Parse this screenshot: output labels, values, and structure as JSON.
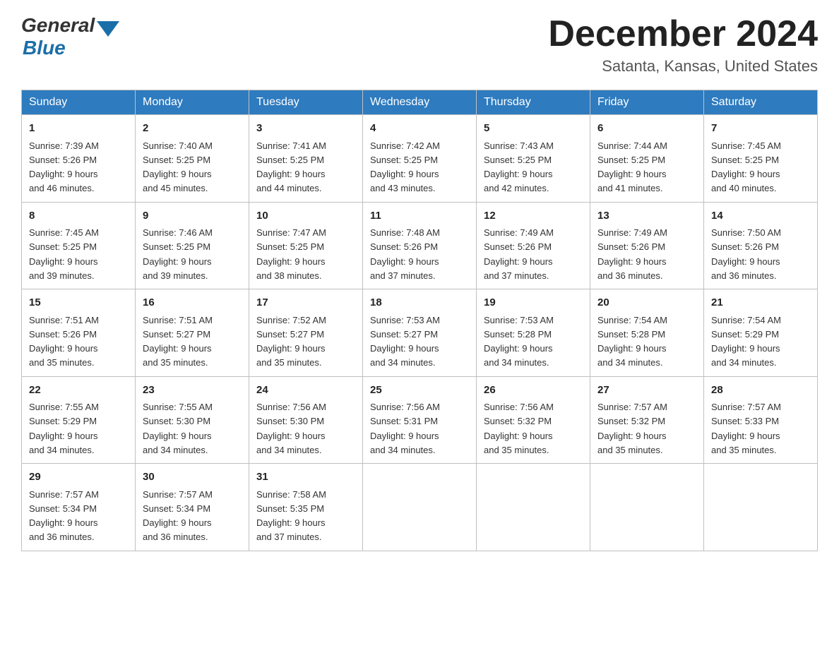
{
  "logo": {
    "general": "General",
    "blue": "Blue",
    "arrow_color": "#1a6fa8"
  },
  "title": {
    "month_year": "December 2024",
    "location": "Satanta, Kansas, United States"
  },
  "days_of_week": [
    "Sunday",
    "Monday",
    "Tuesday",
    "Wednesday",
    "Thursday",
    "Friday",
    "Saturday"
  ],
  "weeks": [
    [
      {
        "day": "1",
        "sunrise": "7:39 AM",
        "sunset": "5:26 PM",
        "daylight": "9 hours and 46 minutes."
      },
      {
        "day": "2",
        "sunrise": "7:40 AM",
        "sunset": "5:25 PM",
        "daylight": "9 hours and 45 minutes."
      },
      {
        "day": "3",
        "sunrise": "7:41 AM",
        "sunset": "5:25 PM",
        "daylight": "9 hours and 44 minutes."
      },
      {
        "day": "4",
        "sunrise": "7:42 AM",
        "sunset": "5:25 PM",
        "daylight": "9 hours and 43 minutes."
      },
      {
        "day": "5",
        "sunrise": "7:43 AM",
        "sunset": "5:25 PM",
        "daylight": "9 hours and 42 minutes."
      },
      {
        "day": "6",
        "sunrise": "7:44 AM",
        "sunset": "5:25 PM",
        "daylight": "9 hours and 41 minutes."
      },
      {
        "day": "7",
        "sunrise": "7:45 AM",
        "sunset": "5:25 PM",
        "daylight": "9 hours and 40 minutes."
      }
    ],
    [
      {
        "day": "8",
        "sunrise": "7:45 AM",
        "sunset": "5:25 PM",
        "daylight": "9 hours and 39 minutes."
      },
      {
        "day": "9",
        "sunrise": "7:46 AM",
        "sunset": "5:25 PM",
        "daylight": "9 hours and 39 minutes."
      },
      {
        "day": "10",
        "sunrise": "7:47 AM",
        "sunset": "5:25 PM",
        "daylight": "9 hours and 38 minutes."
      },
      {
        "day": "11",
        "sunrise": "7:48 AM",
        "sunset": "5:26 PM",
        "daylight": "9 hours and 37 minutes."
      },
      {
        "day": "12",
        "sunrise": "7:49 AM",
        "sunset": "5:26 PM",
        "daylight": "9 hours and 37 minutes."
      },
      {
        "day": "13",
        "sunrise": "7:49 AM",
        "sunset": "5:26 PM",
        "daylight": "9 hours and 36 minutes."
      },
      {
        "day": "14",
        "sunrise": "7:50 AM",
        "sunset": "5:26 PM",
        "daylight": "9 hours and 36 minutes."
      }
    ],
    [
      {
        "day": "15",
        "sunrise": "7:51 AM",
        "sunset": "5:26 PM",
        "daylight": "9 hours and 35 minutes."
      },
      {
        "day": "16",
        "sunrise": "7:51 AM",
        "sunset": "5:27 PM",
        "daylight": "9 hours and 35 minutes."
      },
      {
        "day": "17",
        "sunrise": "7:52 AM",
        "sunset": "5:27 PM",
        "daylight": "9 hours and 35 minutes."
      },
      {
        "day": "18",
        "sunrise": "7:53 AM",
        "sunset": "5:27 PM",
        "daylight": "9 hours and 34 minutes."
      },
      {
        "day": "19",
        "sunrise": "7:53 AM",
        "sunset": "5:28 PM",
        "daylight": "9 hours and 34 minutes."
      },
      {
        "day": "20",
        "sunrise": "7:54 AM",
        "sunset": "5:28 PM",
        "daylight": "9 hours and 34 minutes."
      },
      {
        "day": "21",
        "sunrise": "7:54 AM",
        "sunset": "5:29 PM",
        "daylight": "9 hours and 34 minutes."
      }
    ],
    [
      {
        "day": "22",
        "sunrise": "7:55 AM",
        "sunset": "5:29 PM",
        "daylight": "9 hours and 34 minutes."
      },
      {
        "day": "23",
        "sunrise": "7:55 AM",
        "sunset": "5:30 PM",
        "daylight": "9 hours and 34 minutes."
      },
      {
        "day": "24",
        "sunrise": "7:56 AM",
        "sunset": "5:30 PM",
        "daylight": "9 hours and 34 minutes."
      },
      {
        "day": "25",
        "sunrise": "7:56 AM",
        "sunset": "5:31 PM",
        "daylight": "9 hours and 34 minutes."
      },
      {
        "day": "26",
        "sunrise": "7:56 AM",
        "sunset": "5:32 PM",
        "daylight": "9 hours and 35 minutes."
      },
      {
        "day": "27",
        "sunrise": "7:57 AM",
        "sunset": "5:32 PM",
        "daylight": "9 hours and 35 minutes."
      },
      {
        "day": "28",
        "sunrise": "7:57 AM",
        "sunset": "5:33 PM",
        "daylight": "9 hours and 35 minutes."
      }
    ],
    [
      {
        "day": "29",
        "sunrise": "7:57 AM",
        "sunset": "5:34 PM",
        "daylight": "9 hours and 36 minutes."
      },
      {
        "day": "30",
        "sunrise": "7:57 AM",
        "sunset": "5:34 PM",
        "daylight": "9 hours and 36 minutes."
      },
      {
        "day": "31",
        "sunrise": "7:58 AM",
        "sunset": "5:35 PM",
        "daylight": "9 hours and 37 minutes."
      },
      null,
      null,
      null,
      null
    ]
  ],
  "labels": {
    "sunrise": "Sunrise:",
    "sunset": "Sunset:",
    "daylight": "Daylight:"
  }
}
